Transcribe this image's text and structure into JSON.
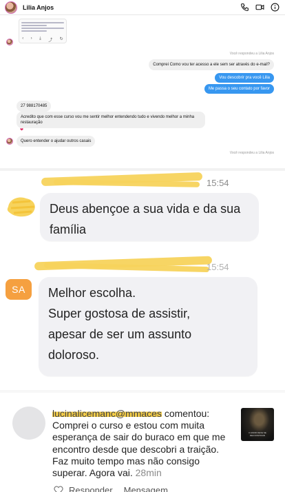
{
  "dm": {
    "contact_name": "Lilia Anjos",
    "shared_post_actions": [
      "‹",
      "›",
      "⤓",
      "⤴",
      "↻"
    ],
    "meta_replied_1": "Você respondeu a Lilia Anjos",
    "messages_outgoing_gray": "Comprei Como vou ter acesso a ele sem ser através do e-mail?",
    "messages_outgoing_blue": [
      "Vou descobrir pra você Lilia",
      "Me passa o seu contato por favor"
    ],
    "phone": "27 988170485",
    "message_long": "Acredito que com esse curso vou me sentir melhor entendendo tudo e vivendo melhor a minha restauração",
    "message_last": "Quero entender o ajudar outros casais",
    "meta_replied_2": "Você respondeu a Lilia Anjos",
    "colors": {
      "blue_bubble": "#3797f0",
      "gray_bubble": "#efefef"
    }
  },
  "comments": {
    "time_1": "15:54",
    "bubble_1": "Deus abençoe a sua vida e da sua família",
    "time_2": "15:54",
    "avatar_initials": "SA",
    "bubble_2_lines": [
      "Melhor escolha.",
      "Super gostosa de assistir,",
      "apesar de ser um assunto",
      "doloroso."
    ],
    "colors": {
      "badge": "#f5a040",
      "scribble": "#f7d35c"
    }
  },
  "notification": {
    "username": "lucinalicemanc@mmaces",
    "action": " comentou:",
    "comment": "Comprei o curso e estou com muita esperança de sair do buraco em que me encontro desde que descobri a traição. Faz muito tempo mas não consigo superar. Agora vai.",
    "time": "28min",
    "thumb_caption": "O AMOR DEVE SE RECONSTRUIR",
    "actions": {
      "reply": "Responder",
      "message": "Mensagem"
    }
  }
}
